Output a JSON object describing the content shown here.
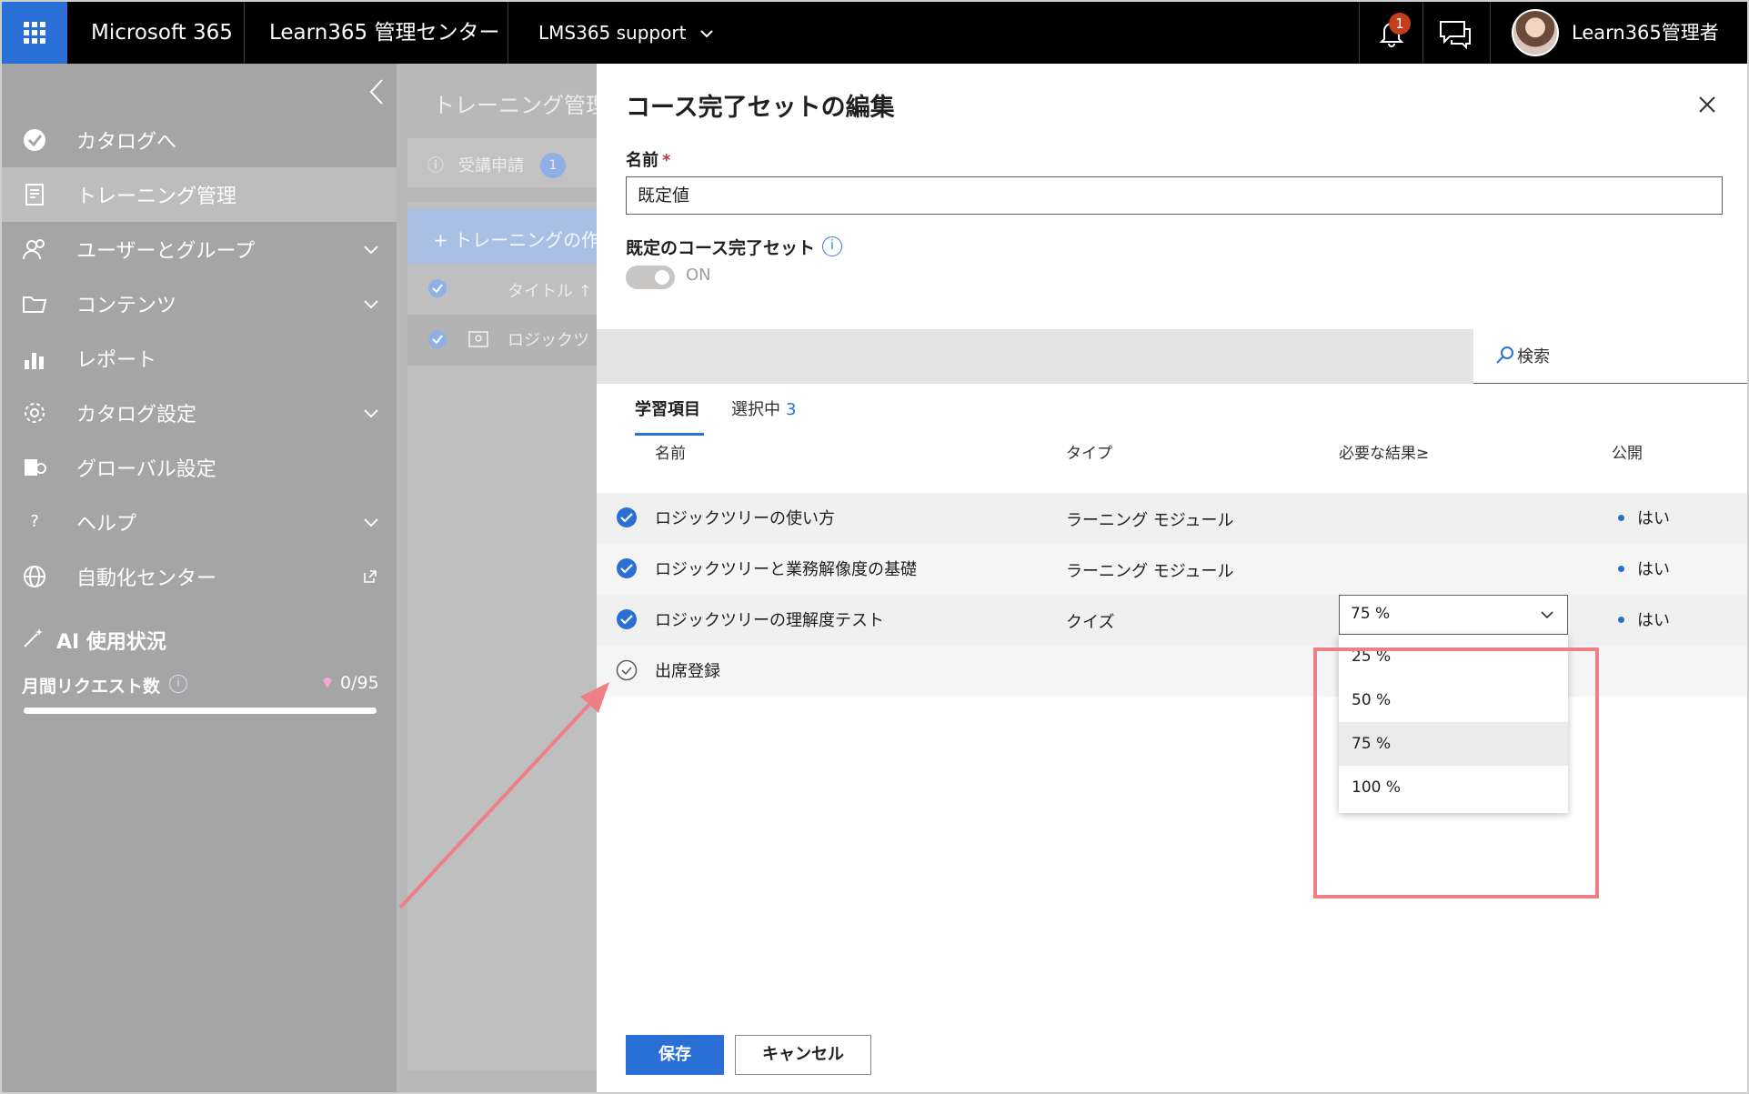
{
  "header": {
    "app_name": "Microsoft 365",
    "center_name": "Learn365 管理センター",
    "tenant": "LMS365 support",
    "notification_count": "1",
    "user_name": "Learn365管理者"
  },
  "sidebar": {
    "items": [
      {
        "label": "カタログへ"
      },
      {
        "label": "トレーニング管理"
      },
      {
        "label": "ユーザーとグループ"
      },
      {
        "label": "コンテンツ"
      },
      {
        "label": "レポート"
      },
      {
        "label": "カタログ設定"
      },
      {
        "label": "グローバル設定"
      },
      {
        "label": "ヘルプ",
        "icon_glyph": "?"
      },
      {
        "label": "自動化センター"
      }
    ],
    "ai_title": "AI 使用状況",
    "requests_label": "月間リクエスト数",
    "requests_count": "0/95",
    "requests_used_fraction": 0
  },
  "background": {
    "page_title": "トレーニング管理",
    "tab_label": "受講申請",
    "tab_badge": "1",
    "create_label": "+ トレーニングの作",
    "col_title": "タイトル ↑",
    "row_label": "ロジックツ"
  },
  "panel": {
    "title": "コース完了セットの編集",
    "name_label": "名前",
    "name_required_mark": "*",
    "name_value": "既定値",
    "default_label": "既定のコース完了セット",
    "toggle_label": "ON",
    "search_placeholder": "検索",
    "tabs": {
      "learning": "学習項目",
      "selected": "選択中",
      "selected_count": "3"
    },
    "columns": {
      "name": "名前",
      "type": "タイプ",
      "result": "必要な結果≥",
      "published": "公開"
    },
    "rows": [
      {
        "name": "ロジックツリーの使い方",
        "type": "ラーニング モジュール",
        "published": "はい",
        "checked": true
      },
      {
        "name": "ロジックツリーと業務解像度の基礎",
        "type": "ラーニング モジュール",
        "published": "はい",
        "checked": true
      },
      {
        "name": "ロジックツリーの理解度テスト",
        "type": "クイズ",
        "published": "はい",
        "checked": true
      },
      {
        "name": "出席登録",
        "type": "",
        "published": "",
        "checked": false
      }
    ],
    "dropdown": {
      "value": "75 %",
      "options": [
        "25 %",
        "50 %",
        "75 %",
        "100 %"
      ],
      "selected_index": 2
    },
    "save_label": "保存",
    "cancel_label": "キャンセル"
  },
  "colors": {
    "accent": "#2a6fd6",
    "highlight": "#ee7f86",
    "sidebar": "#a5a5a5",
    "topbar": "#000000"
  }
}
